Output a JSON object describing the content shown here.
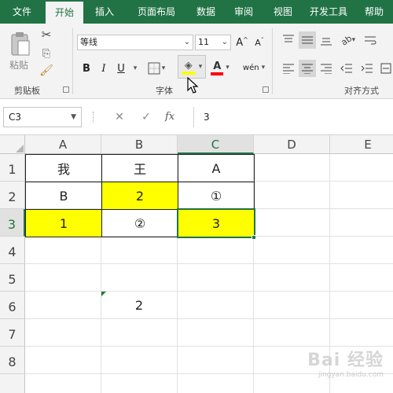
{
  "ribbon_tabs": [
    "文件",
    "开始",
    "插入",
    "页面布局",
    "数据",
    "审阅",
    "视图",
    "开发工具",
    "帮助"
  ],
  "active_tab": "开始",
  "clipboard": {
    "paste_label": "粘贴",
    "group_label": "剪贴板"
  },
  "font": {
    "family": "等线",
    "size": "11",
    "group_label": "字体",
    "bold": "B",
    "italic": "I",
    "underline": "U",
    "grow": "A",
    "shrink": "A",
    "phonetic": "wén",
    "fill_color": "#ffff00",
    "font_color": "#ff0000"
  },
  "alignment": {
    "group_label": "对齐方式"
  },
  "formula_bar": {
    "name_box": "C3",
    "value": "3",
    "fx_label": "fx"
  },
  "columns": [
    "A",
    "B",
    "C",
    "D",
    "E"
  ],
  "selected_column": "C",
  "rows": [
    "1",
    "2",
    "3",
    "4",
    "5",
    "6",
    "7",
    "8"
  ],
  "selected_row": "3",
  "cells": {
    "A1": "我",
    "B1": "王",
    "C1": "A",
    "A2": "B",
    "B2": "2",
    "C2": "①",
    "A3": "1",
    "B3": "②",
    "C3": "3",
    "B6": "2"
  },
  "highlight_color": "#ffff00",
  "watermark": {
    "main": "Bai 经验",
    "sub": "jingyan.baidu.com"
  }
}
